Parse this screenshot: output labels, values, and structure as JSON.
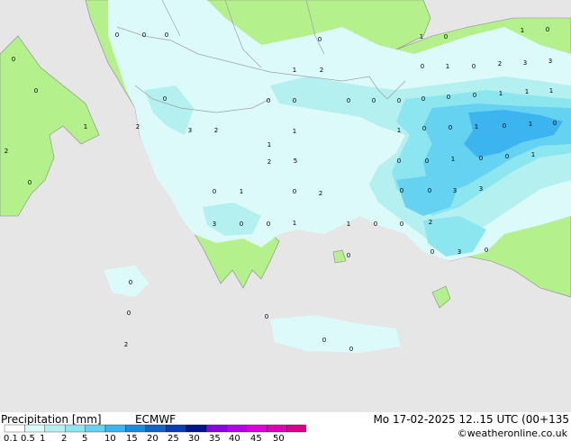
{
  "title": "Precipitation [mm]",
  "model": "ECMWF",
  "timestamp": "Mo 17-02-2025 12..15 UTC (00+135",
  "credit": "©weatheronline.co.uk",
  "colors": {
    "sea": "#e6e6e6",
    "land": "#b4f08c",
    "border": "#a0a0a0",
    "coast": "#888888"
  },
  "legend": {
    "labels": [
      "0.1",
      "0.5",
      "1",
      "2",
      "5",
      "10",
      "15",
      "20",
      "25",
      "30",
      "35",
      "40",
      "45",
      "50"
    ],
    "colors": [
      "#ffffff",
      "#dcfafa",
      "#b4f0f0",
      "#8ce6f0",
      "#64d2f0",
      "#3cb4f0",
      "#1e8cdc",
      "#1464c8",
      "#0a3cb4",
      "#00148c",
      "#8c00e6",
      "#b400e6",
      "#dc00dc",
      "#dc00b4",
      "#dc008c"
    ]
  },
  "map_values": [
    "0",
    "0",
    "0",
    "0",
    "1",
    "0",
    "1",
    "0",
    "0",
    "1",
    "2",
    "0",
    "1",
    "0",
    "2",
    "3",
    "3",
    "0",
    "0",
    "0",
    "0",
    "0",
    "0",
    "0",
    "0",
    "0",
    "0",
    "1",
    "1",
    "1",
    "1",
    "2",
    "3",
    "2",
    "1",
    "1",
    "0",
    "0",
    "1",
    "0",
    "1",
    "0",
    "2",
    "1",
    "5",
    "2",
    "0",
    "0",
    "1",
    "0",
    "0",
    "1",
    "0",
    "0",
    "1",
    "0",
    "2",
    "0",
    "0",
    "3",
    "3",
    "3",
    "0",
    "0",
    "1",
    "1",
    "0",
    "0",
    "2",
    "3",
    "0",
    "0",
    "0",
    "0",
    "0",
    "2",
    "0",
    "0",
    "0"
  ]
}
